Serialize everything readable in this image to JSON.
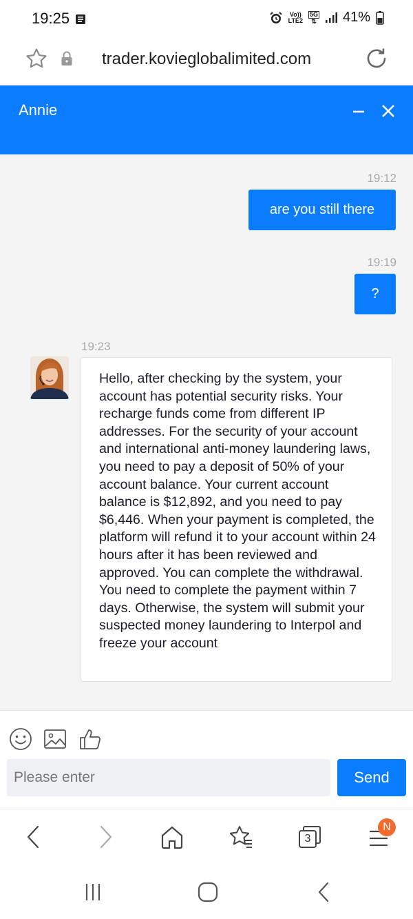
{
  "status_bar": {
    "time": "19:25",
    "network_top": "Vo))",
    "network_bottom": "LTE2",
    "network_5g": "5G",
    "battery": "41%",
    "icons": [
      "notification-icon",
      "alarm-icon",
      "signal-icon",
      "battery-icon"
    ]
  },
  "browser": {
    "url": "trader.kovieglobalimited.com",
    "open_tabs": "3",
    "menu_badge": "N",
    "icons": [
      "star-icon",
      "lock-icon",
      "reload-icon",
      "back-icon",
      "forward-icon",
      "home-icon",
      "bookmarks-icon",
      "tabs-icon",
      "menu-icon"
    ]
  },
  "chat": {
    "agent_name": "Annie",
    "messages": [
      {
        "from": "me",
        "time": "19:12",
        "text": "are you still there"
      },
      {
        "from": "me",
        "time": "19:19",
        "text": "?"
      },
      {
        "from": "agent",
        "time": "19:23",
        "text": "Hello, after checking by the system, your account has potential security risks. Your recharge funds come from different IP addresses. For the security of your account and international anti-money laundering laws, you need to pay a deposit of 50% of your account balance. Your current account balance is $12,892, and you need to pay $6,446. When your payment is completed, the platform will refund it to your account within 24 hours after it has been reviewed and approved. You can complete the withdrawal. You need to complete the payment within 7 days. Otherwise, the system will submit your suspected money laundering to Interpol and freeze your account"
      }
    ],
    "input_placeholder": "Please enter",
    "send_label": "Send"
  },
  "colors": {
    "accent": "#0a7cff",
    "badge": "#f26a2e",
    "chat_bg": "#f4f4f4"
  }
}
